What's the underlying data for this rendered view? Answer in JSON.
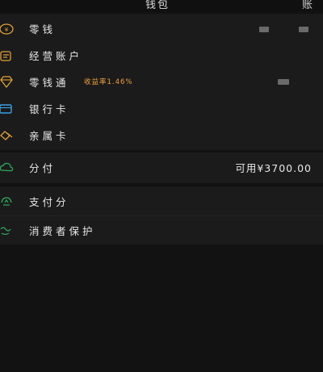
{
  "header": {
    "title": "钱包",
    "right_title": "账"
  },
  "colors": {
    "accent_gold": "#e0a234",
    "accent_orange": "#f0a33a",
    "accent_blue": "#3aa0e8",
    "accent_green": "#2ea95c",
    "background": "#121212",
    "card": "#1b1b1b"
  },
  "section1": {
    "items": [
      {
        "label": "零钱",
        "icon": "yen-coin-icon"
      },
      {
        "label": "经营账户",
        "icon": "business-account-icon"
      },
      {
        "label": "零钱通",
        "badge": "收益率1.46%",
        "icon": "diamond-icon"
      },
      {
        "label": "银行卡",
        "icon": "bank-card-icon"
      },
      {
        "label": "亲属卡",
        "icon": "family-card-icon"
      }
    ]
  },
  "section2": {
    "items": [
      {
        "label": "分付",
        "value": "可用¥3700.00",
        "icon": "credit-cloud-icon"
      }
    ]
  },
  "section3": {
    "items": [
      {
        "label": "支付分",
        "icon": "payment-score-icon"
      },
      {
        "label": "消费者保护",
        "icon": "consumer-protection-icon"
      }
    ]
  }
}
